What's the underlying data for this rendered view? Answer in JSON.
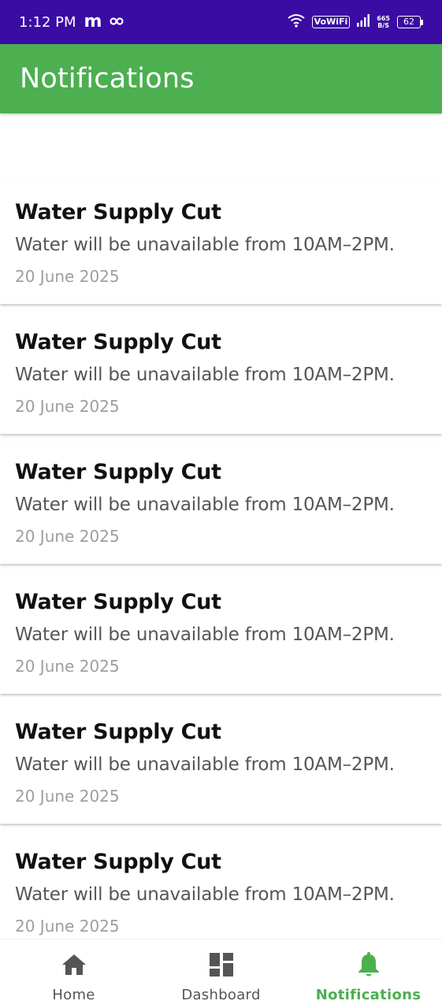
{
  "status_bar": {
    "time": "1:12 PM",
    "carrier_glyph": "m",
    "vowifi": "VoWiFi",
    "speed_value": "665",
    "speed_unit": "B/S",
    "battery": "62",
    "background_color": "#3a0ca3"
  },
  "app_bar": {
    "title": "Notifications",
    "color": "#4caf50"
  },
  "notifications": [
    {
      "title": "Water Supply Cut",
      "message": "Water will be unavailable from 10AM–2PM.",
      "date": "20 June 2025"
    },
    {
      "title": "Water Supply Cut",
      "message": "Water will be unavailable from 10AM–2PM.",
      "date": "20 June 2025"
    },
    {
      "title": "Water Supply Cut",
      "message": "Water will be unavailable from 10AM–2PM.",
      "date": "20 June 2025"
    },
    {
      "title": "Water Supply Cut",
      "message": "Water will be unavailable from 10AM–2PM.",
      "date": "20 June 2025"
    },
    {
      "title": "Water Supply Cut",
      "message": "Water will be unavailable from 10AM–2PM.",
      "date": "20 June 2025"
    },
    {
      "title": "Water Supply Cut",
      "message": "Water will be unavailable from 10AM–2PM.",
      "date": "20 June 2025"
    }
  ],
  "bottom_nav": {
    "items": [
      {
        "label": "Home",
        "icon": "home-icon",
        "active": false
      },
      {
        "label": "Dashboard",
        "icon": "dashboard-icon",
        "active": false
      },
      {
        "label": "Notifications",
        "icon": "bell-icon",
        "active": true
      }
    ],
    "active_color": "#4caf50",
    "inactive_color": "#555555"
  }
}
